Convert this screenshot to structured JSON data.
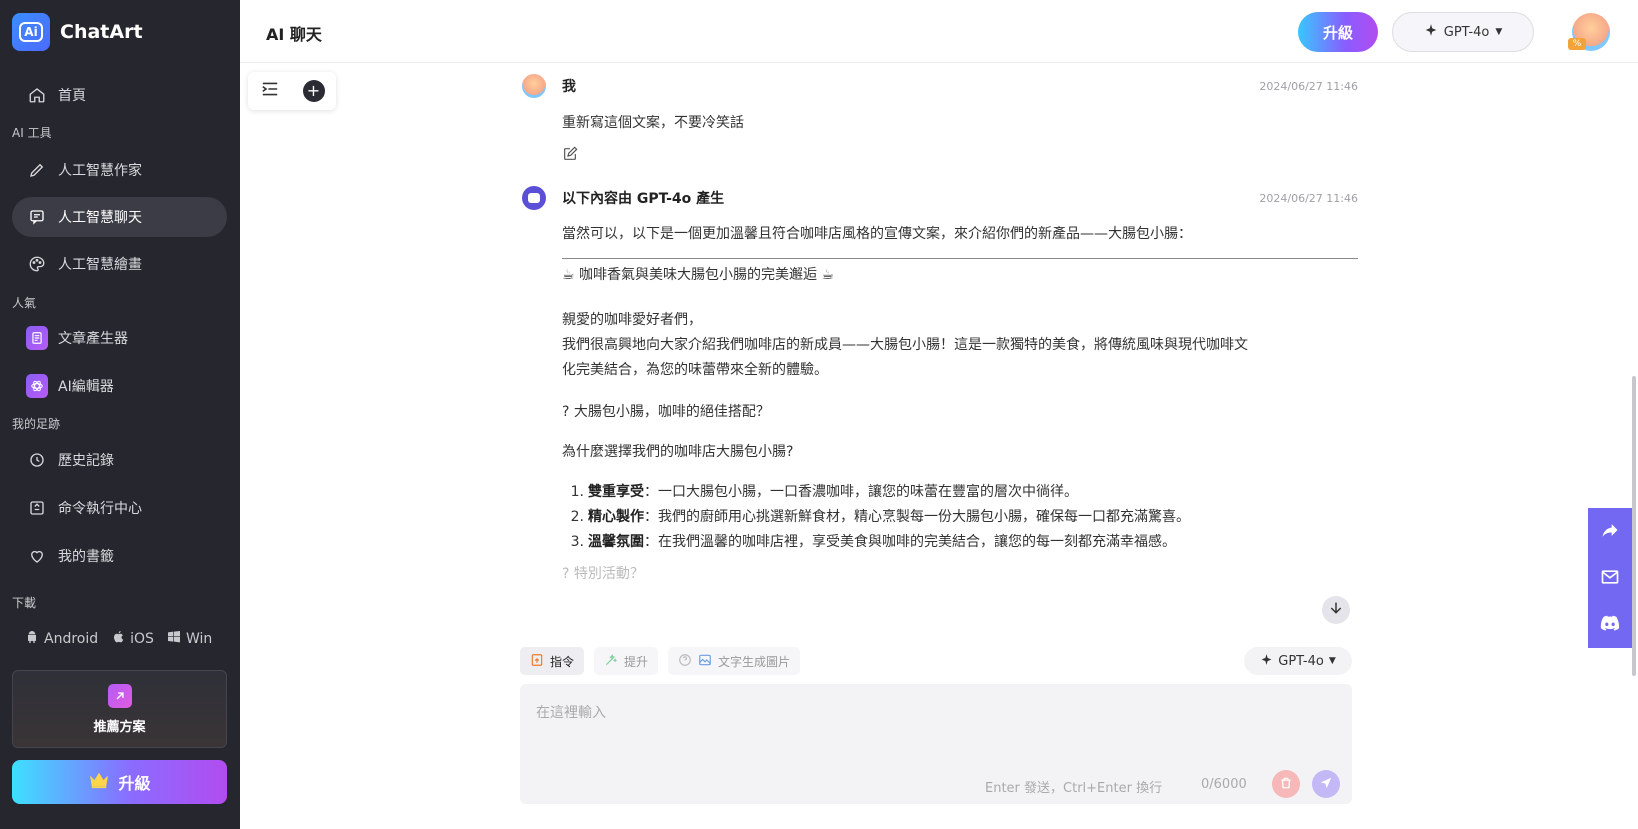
{
  "app": {
    "name": "ChatArt",
    "logo_text": "Ai"
  },
  "sidebar": {
    "home": "首頁",
    "section_ai_tools": "AI 工具",
    "ai_writer": "人工智慧作家",
    "ai_chat": "人工智慧聊天",
    "ai_painting": "人工智慧繪畫",
    "section_popular": "人氣",
    "article_generator": "文章產生器",
    "ai_editor": "AI編輯器",
    "section_footprint": "我的足跡",
    "history": "歷史記錄",
    "command_center": "命令執行中心",
    "bookmarks": "我的書籤",
    "section_download": "下載",
    "download_android": "Android",
    "download_ios": "iOS",
    "download_win": "Win",
    "recommend": "推薦方案",
    "upgrade": "升級"
  },
  "header": {
    "title": "AI 聊天",
    "upgrade": "升級",
    "model": "GPT-4o",
    "avatar_badge": "%"
  },
  "messages": {
    "user": {
      "name": "我",
      "time": "2024/06/27 11:46",
      "text": "重新寫這個文案，不要冷笑話"
    },
    "bot": {
      "name": "以下內容由 GPT-4o 產生",
      "time": "2024/06/27 11:46",
      "intro": "當然可以，以下是一個更加溫馨且符合咖啡店風格的宣傳文案，來介紹你們的新產品——大腸包小腸：",
      "headline": "☕ 咖啡香氣與美味大腸包小腸的完美邂逅 ☕",
      "greeting": "親愛的咖啡愛好者們，",
      "para_line1": "我們很高興地向大家介紹我們咖啡店的新成員——大腸包小腸！這是一款獨特的美食，將傳統風味與現代咖啡文",
      "para_line2": "化完美結合，為您的味蕾帶來全新的體驗。",
      "q1": "? 大腸包小腸，咖啡的絕佳搭配？",
      "q2": "為什麼選擇我們的咖啡店大腸包小腸?",
      "list": [
        {
          "num": "1.",
          "title": "雙重享受",
          "text": "：一口大腸包小腸，一口香濃咖啡，讓您的味蕾在豐富的層次中徜徉。"
        },
        {
          "num": "2.",
          "title": "精心製作",
          "text": "：我們的廚師用心挑選新鮮食材，精心烹製每一份大腸包小腸，確保每一口都充滿驚喜。"
        },
        {
          "num": "3.",
          "title": "溫馨氛圍",
          "text": "：在我們溫馨的咖啡店裡，享受美食與咖啡的完美結合，讓您的每一刻都充滿幸福感。"
        }
      ],
      "q3": "? 特別活動？"
    }
  },
  "composer": {
    "chip_command": "指令",
    "chip_boost": "提升",
    "chip_text_to_image": "文字生成圖片",
    "model": "GPT-4o",
    "placeholder": "在這裡輸入",
    "hint": "Enter 發送，Ctrl+Enter 換行",
    "count": "0/6000"
  }
}
